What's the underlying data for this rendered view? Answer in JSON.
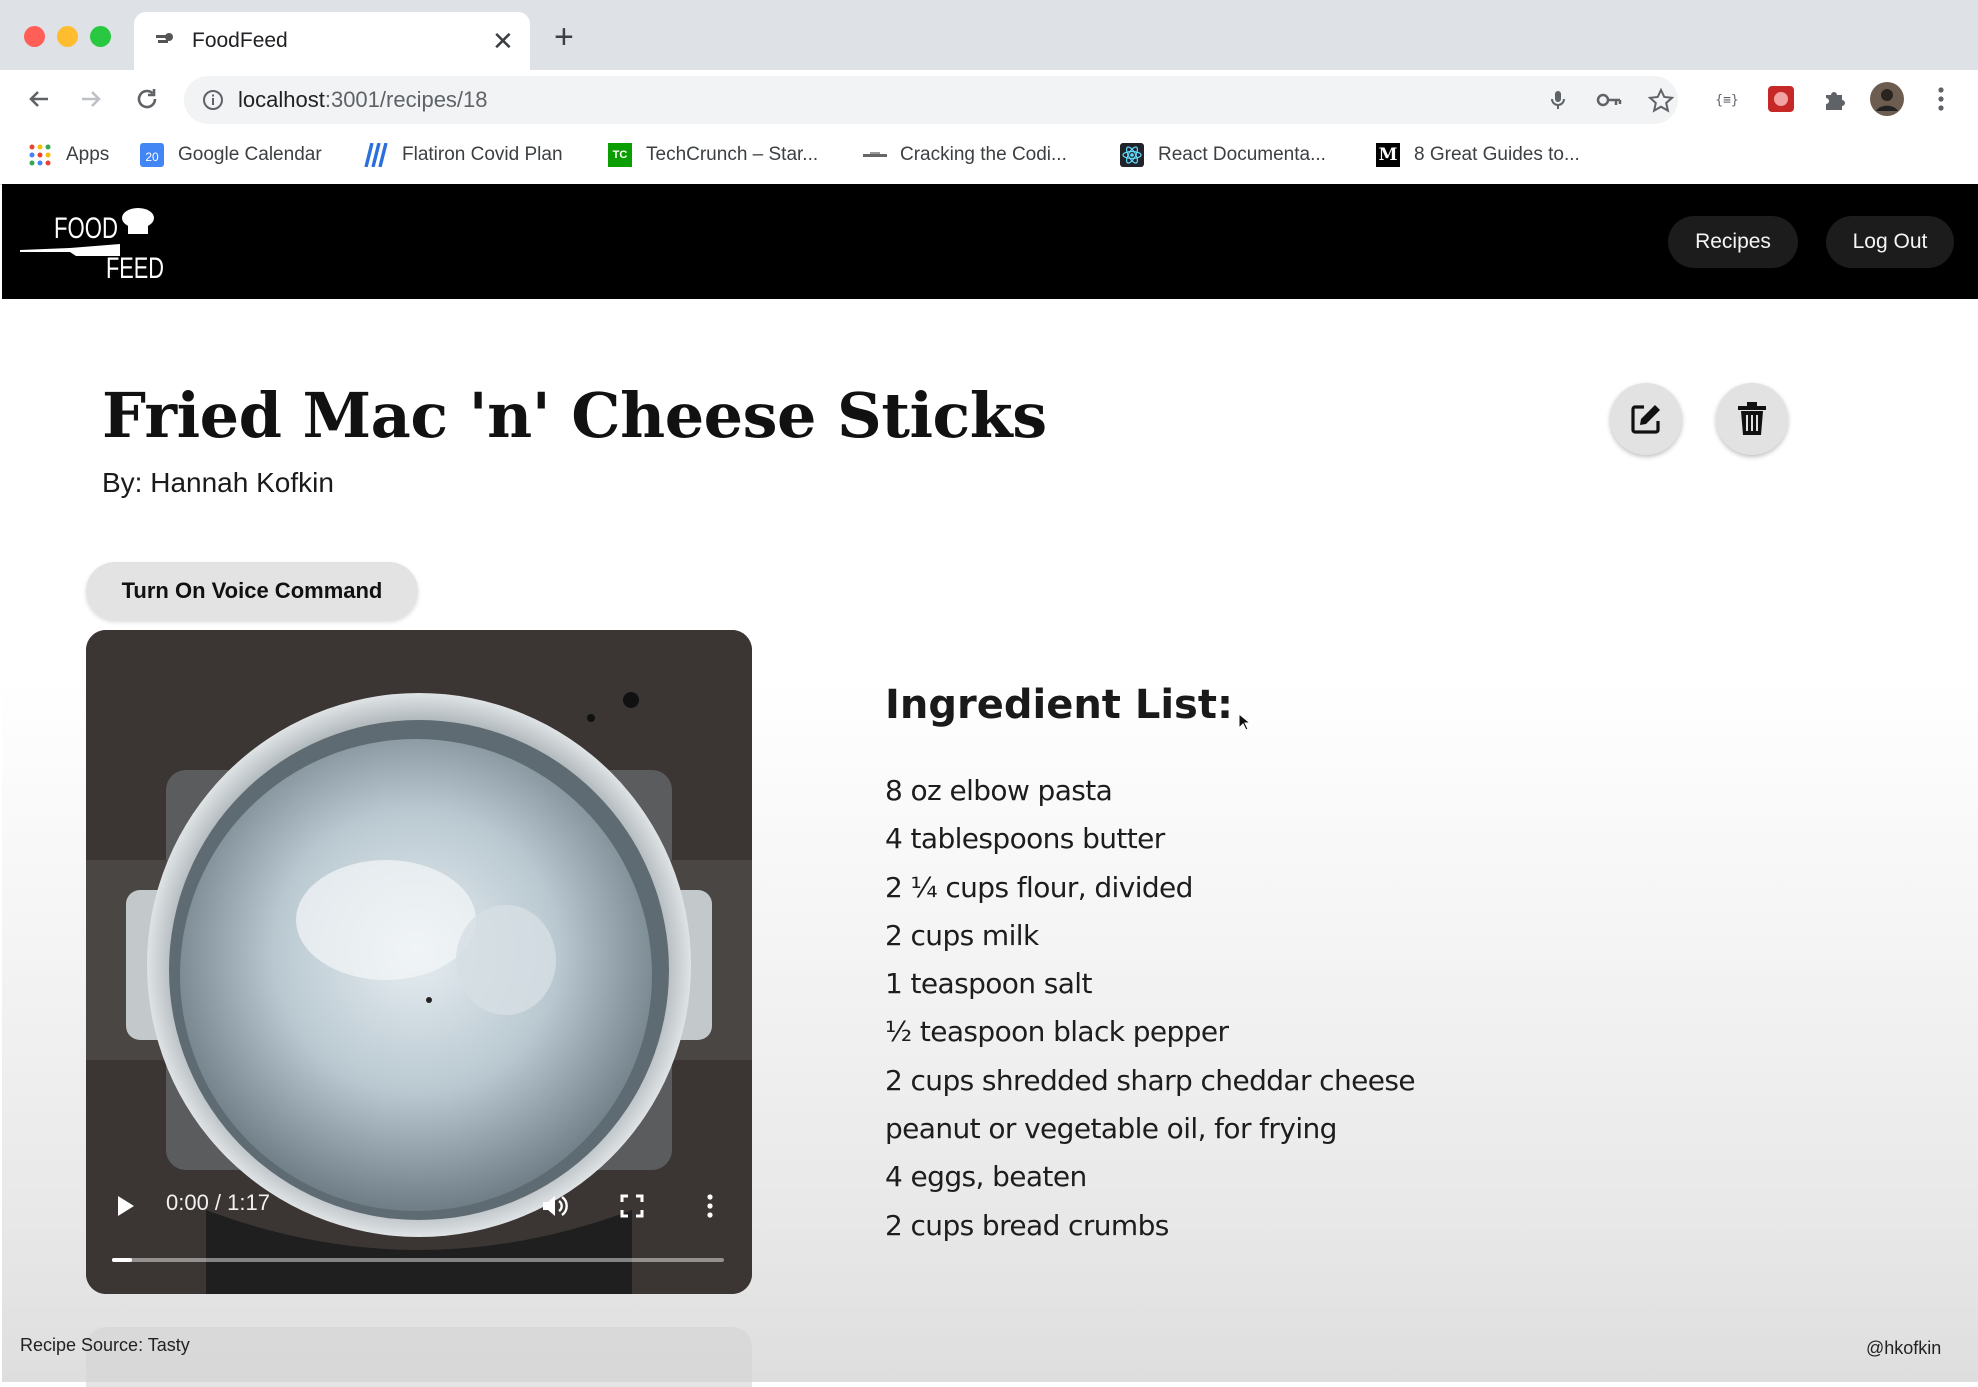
{
  "browser": {
    "tab_title": "FoodFeed",
    "url_host": "localhost",
    "url_path": ":3001/recipes/18",
    "bookmarks": [
      {
        "label": "Apps",
        "icon": "apps-grid-icon"
      },
      {
        "label": "Google Calendar",
        "icon": "calendar-icon"
      },
      {
        "label": "Flatiron Covid Plan",
        "icon": "flatiron-icon"
      },
      {
        "label": "TechCrunch – Star...",
        "icon": "techcrunch-icon"
      },
      {
        "label": "Cracking the Codi...",
        "icon": "bookmark-site-icon"
      },
      {
        "label": "React Documenta...",
        "icon": "react-icon"
      },
      {
        "label": "8 Great Guides to...",
        "icon": "medium-icon"
      }
    ],
    "calendar_day": "20",
    "tc_text": "TC",
    "medium_text": "M"
  },
  "header": {
    "logo_top": "FOOD",
    "logo_bottom": "FEED",
    "nav": {
      "recipes": "Recipes",
      "logout": "Log Out"
    }
  },
  "recipe": {
    "title": "Fried Mac 'n' Cheese Sticks",
    "author_line": "By: Hannah Kofkin",
    "voice_button": "Turn On Voice Command",
    "video": {
      "time": "0:00 / 1:17",
      "progress": 0
    },
    "ingredients_heading": "Ingredient List:",
    "ingredients": [
      "8 oz elbow pasta",
      "4 tablespoons butter",
      "2 ¼ cups flour, divided",
      "2 cups milk",
      "1 teaspoon salt",
      "½ teaspoon black pepper",
      "2 cups shredded sharp cheddar cheese",
      "peanut or vegetable oil, for frying",
      "4 eggs, beaten",
      "2 cups bread crumbs"
    ]
  },
  "footer": {
    "source": "Recipe Source: Tasty",
    "handle": "@hkofkin"
  },
  "colors": {
    "header_bg": "#000000",
    "chrome_bg": "#dee1e6",
    "pill_bg": "#1c1c1c"
  }
}
